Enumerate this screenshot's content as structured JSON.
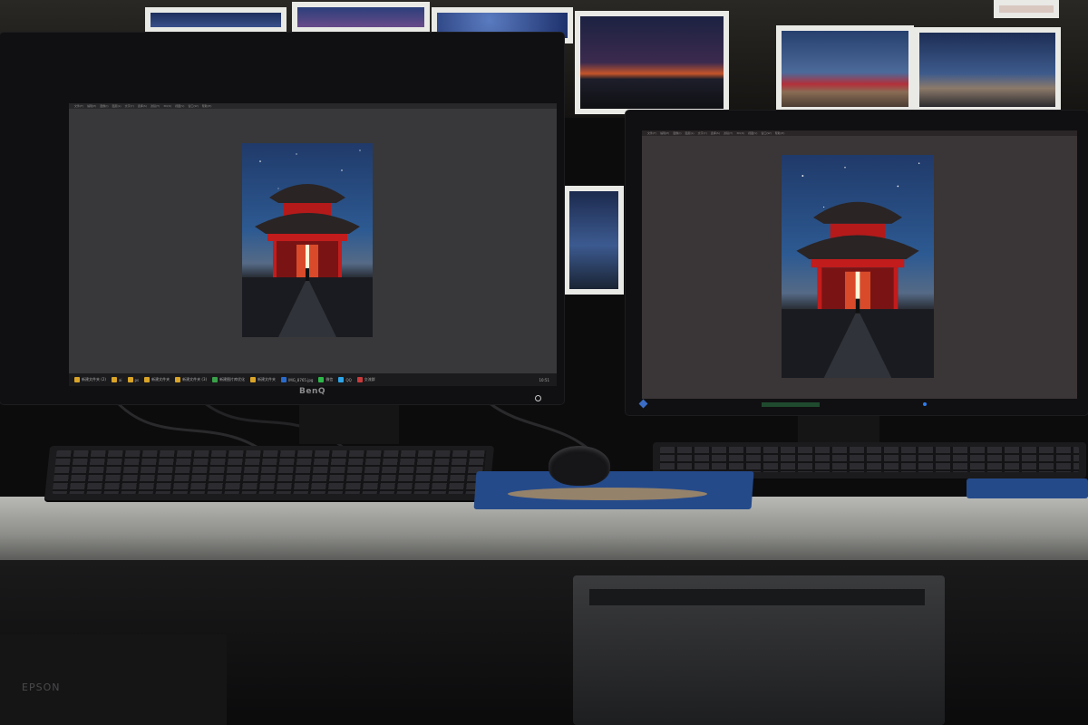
{
  "scene": {
    "left_monitor": {
      "brand": "BenQ",
      "menu_items": [
        "文件(F)",
        "编辑(E)",
        "图像(I)",
        "图层(L)",
        "文字(Y)",
        "选择(S)",
        "滤镜(T)",
        "3D(D)",
        "视图(V)",
        "窗口(W)",
        "帮助(H)"
      ],
      "taskbar_items": [
        "新建文件夹 (2)",
        "ai",
        "ps",
        "新建文件夹",
        "新建文件夹 (3)",
        "新建图片库优化",
        "新建文件夹",
        "IMG_8765.jpg",
        "微信",
        "QQ",
        "交流群"
      ],
      "clock": "10:51"
    },
    "right_monitor": {
      "menu_items": [
        "文件(F)",
        "编辑(E)",
        "图像(I)",
        "图层(L)",
        "文字(Y)",
        "选择(S)",
        "滤镜(T)",
        "3D(D)",
        "视图(V)",
        "窗口(W)",
        "帮助(H)"
      ]
    },
    "under_desk": {
      "printer_brand": "EPSON"
    }
  },
  "colors": {
    "sky_top": "#1d3566",
    "sky_bottom": "#5b7396",
    "temple_red": "#c21c1c",
    "temple_roof": "#2a2424",
    "light_glow": "#fff6d8"
  }
}
